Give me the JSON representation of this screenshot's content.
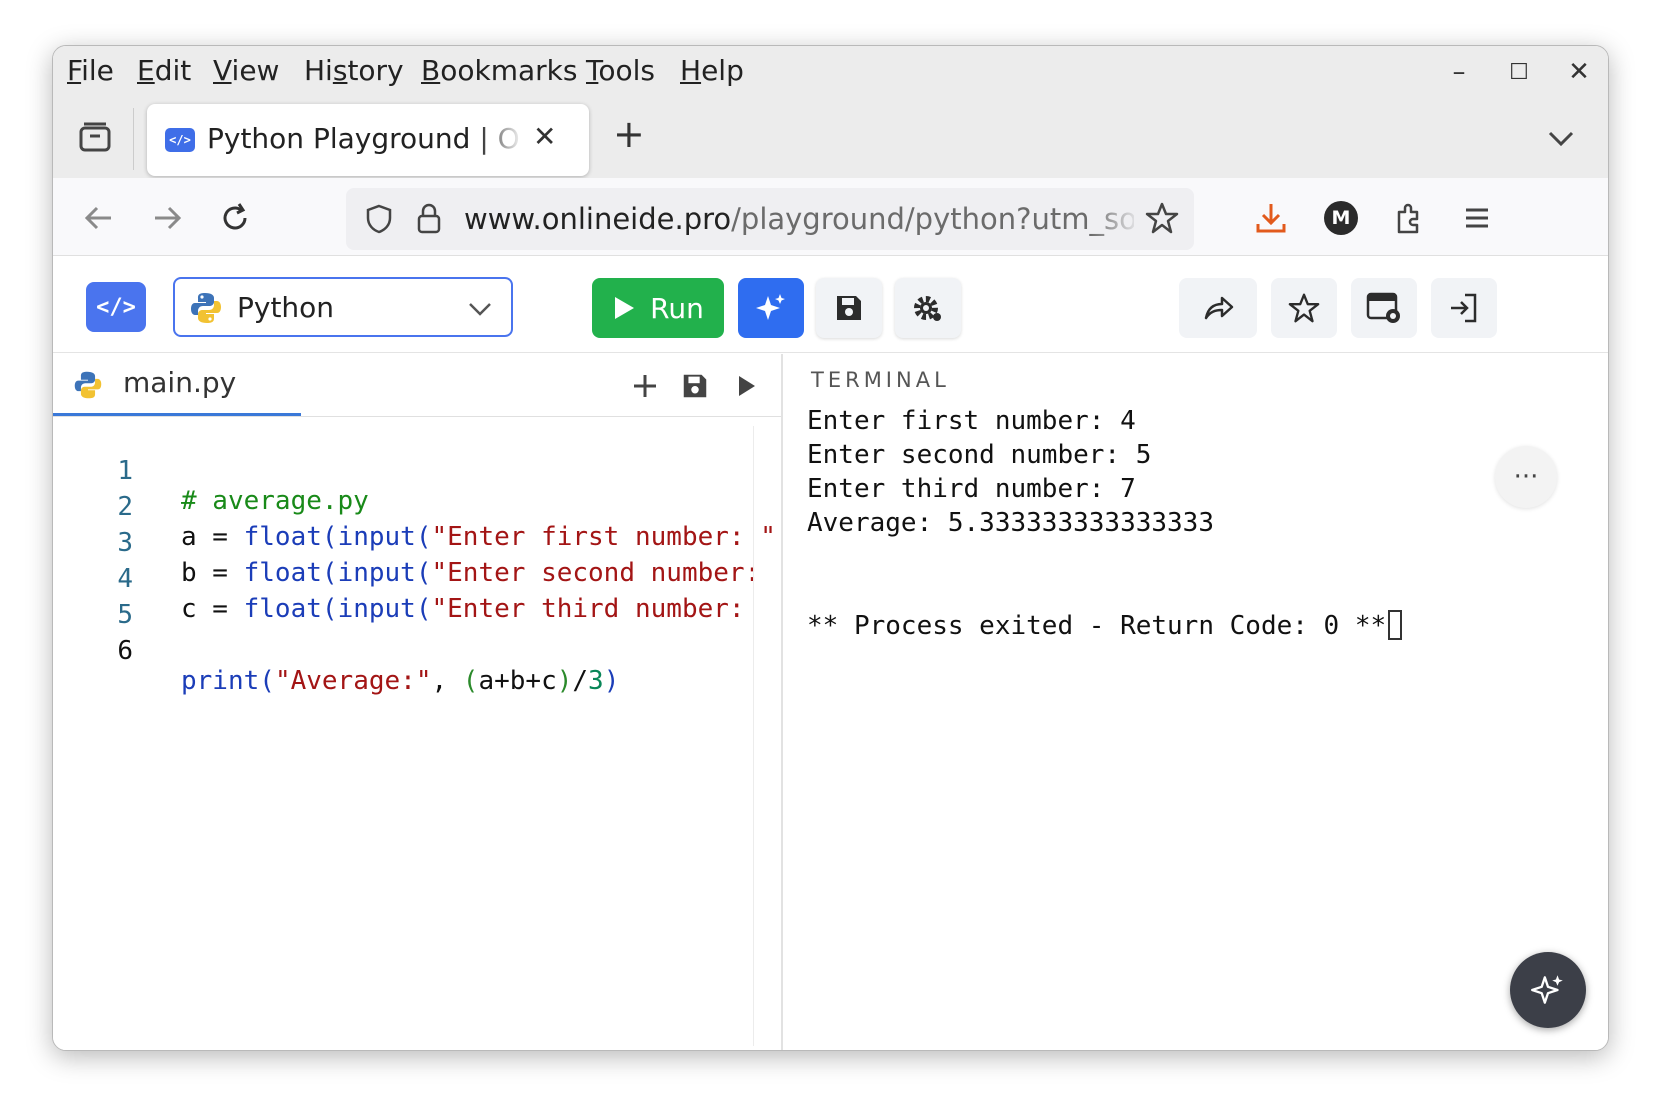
{
  "menu": {
    "items": [
      {
        "ul": "F",
        "rest": "ile"
      },
      {
        "ul": "E",
        "rest": "dit"
      },
      {
        "ul": "V",
        "rest": "iew"
      },
      {
        "pre": "Hi",
        "ul": "s",
        "rest": "tory"
      },
      {
        "ul": "B",
        "rest": "ookmarks"
      },
      {
        "ul": "T",
        "rest": "ools"
      },
      {
        "ul": "H",
        "rest": "elp"
      }
    ],
    "window_controls": {
      "minimize": "–",
      "maximize": "☐",
      "close": "✕"
    }
  },
  "tab": {
    "title": "Python Playground | Online IDE",
    "favicon_text": "</>",
    "close": "✕",
    "new_tab": "+"
  },
  "nav": {
    "url_host": "www.onlineide.pro",
    "url_path": "/playground/python?utm_source=",
    "account_initial": "M"
  },
  "toolbar": {
    "logo_text": "</>",
    "language": "Python",
    "run_label": "Run"
  },
  "editor": {
    "filename": "main.py",
    "lines": [
      {
        "num": "1"
      },
      {
        "num": "2"
      },
      {
        "num": "3"
      },
      {
        "num": "4"
      },
      {
        "num": "5"
      },
      {
        "num": "6"
      }
    ],
    "code": {
      "l1": "# average.py",
      "l2a": "a = ",
      "l2fn": "float",
      "l2b": "(",
      "l2fn2": "input",
      "l2c": "(",
      "l2s": "\"Enter first number: \"",
      "l3a": "b = ",
      "l3fn": "float",
      "l3b": "(",
      "l3fn2": "input",
      "l3c": "(",
      "l3s": "\"Enter second number: ",
      "l4a": "c = ",
      "l4fn": "float",
      "l4b": "(",
      "l4fn2": "input",
      "l4c": "(",
      "l4s": "\"Enter third number: ",
      "l6fn": "print",
      "l6b": "(",
      "l6s": "\"Average:\"",
      "l6c": ", ",
      "l6d": "(",
      "l6e": "a+b+c",
      "l6f": ")",
      "l6g": "/",
      "l6n": "3",
      "l6h": ")"
    }
  },
  "terminal": {
    "title": "TERMINAL",
    "lines": [
      "Enter first number: 4",
      "Enter second number: 5",
      "Enter third number: 7",
      "Average: 5.333333333333333",
      "",
      "",
      "** Process exited - Return Code: 0 **"
    ],
    "more": "···"
  }
}
